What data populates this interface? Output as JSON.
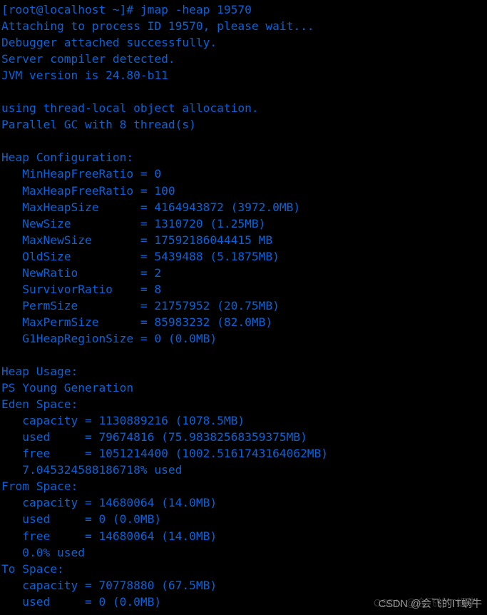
{
  "terminal": {
    "foreground_color": "#0a62d8",
    "background_color": "#000000",
    "prompt": "[root@localhost ~]#",
    "command": "jmap -heap 19570",
    "lines": [
      "[root@localhost ~]# jmap -heap 19570",
      "Attaching to process ID 19570, please wait...",
      "Debugger attached successfully.",
      "Server compiler detected.",
      "JVM version is 24.80-b11",
      "",
      "using thread-local object allocation.",
      "Parallel GC with 8 thread(s)",
      "",
      "Heap Configuration:",
      "   MinHeapFreeRatio = 0",
      "   MaxHeapFreeRatio = 100",
      "   MaxHeapSize      = 4164943872 (3972.0MB)",
      "   NewSize          = 1310720 (1.25MB)",
      "   MaxNewSize       = 17592186044415 MB",
      "   OldSize          = 5439488 (5.1875MB)",
      "   NewRatio         = 2",
      "   SurvivorRatio    = 8",
      "   PermSize         = 21757952 (20.75MB)",
      "   MaxPermSize      = 85983232 (82.0MB)",
      "   G1HeapRegionSize = 0 (0.0MB)",
      "",
      "Heap Usage:",
      "PS Young Generation",
      "Eden Space:",
      "   capacity = 1130889216 (1078.5MB)",
      "   used     = 79674816 (75.98382568359375MB)",
      "   free     = 1051214400 (1002.5161743164062MB)",
      "   7.045324588186718% used",
      "From Space:",
      "   capacity = 14680064 (14.0MB)",
      "   used     = 0 (0.0MB)",
      "   free     = 14680064 (14.0MB)",
      "   0.0% used",
      "To Space:",
      "   capacity = 70778880 (67.5MB)",
      "   used     = 0 (0.0MB)"
    ]
  },
  "jvm_info": {
    "process_id": "19570",
    "attaching_message": "Attaching to process ID 19570, please wait...",
    "debugger_message": "Debugger attached successfully.",
    "compiler_message": "Server compiler detected.",
    "jvm_version": "24.80-b11",
    "allocation_mode": "using thread-local object allocation.",
    "gc_type": "Parallel GC with 8 thread(s)",
    "gc_threads": "8"
  },
  "heap_configuration": {
    "title": "Heap Configuration:",
    "entries": [
      {
        "name": "MinHeapFreeRatio",
        "value": "0"
      },
      {
        "name": "MaxHeapFreeRatio",
        "value": "100"
      },
      {
        "name": "MaxHeapSize",
        "value": "4164943872 (3972.0MB)"
      },
      {
        "name": "NewSize",
        "value": "1310720 (1.25MB)"
      },
      {
        "name": "MaxNewSize",
        "value": "17592186044415 MB"
      },
      {
        "name": "OldSize",
        "value": "5439488 (5.1875MB)"
      },
      {
        "name": "NewRatio",
        "value": "2"
      },
      {
        "name": "SurvivorRatio",
        "value": "8"
      },
      {
        "name": "PermSize",
        "value": "21757952 (20.75MB)"
      },
      {
        "name": "MaxPermSize",
        "value": "85983232 (82.0MB)"
      },
      {
        "name": "G1HeapRegionSize",
        "value": "0 (0.0MB)"
      }
    ]
  },
  "heap_usage": {
    "title": "Heap Usage:",
    "generation": "PS Young Generation",
    "spaces": [
      {
        "name": "Eden Space:",
        "capacity": "1130889216 (1078.5MB)",
        "used": "79674816 (75.98382568359375MB)",
        "free": "1051214400 (1002.5161743164062MB)",
        "percent_used": "7.045324588186718% used"
      },
      {
        "name": "From Space:",
        "capacity": "14680064 (14.0MB)",
        "used": "0 (0.0MB)",
        "free": "14680064 (14.0MB)",
        "percent_used": "0.0% used"
      },
      {
        "name": "To Space:",
        "capacity": "70778880 (67.5MB)",
        "used": "0 (0.0MB)"
      }
    ]
  },
  "watermark": {
    "text": "CSDN @会飞的IT蜗牛"
  }
}
